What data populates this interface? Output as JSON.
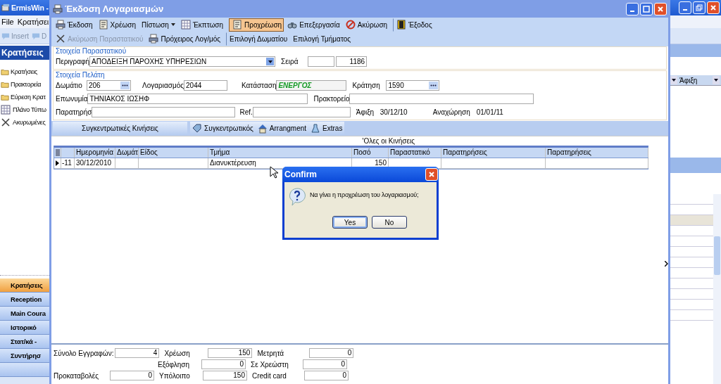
{
  "app": {
    "title": "ErmisWin -",
    "menu": [
      "File",
      "Κρατήσει"
    ],
    "toolbar": [
      "Insert",
      "D"
    ],
    "panel_title": "Κρατήσεις",
    "panel_items": [
      "Κρατήσεις",
      "Πρακτορεία",
      "Εύρεση Κρατ",
      "Πλάνο Τύπω",
      "Ακυρωμένες"
    ],
    "nav_buttons": [
      {
        "label": "Κρατήσεις",
        "selected": true
      },
      {
        "label": "Reception",
        "selected": false
      },
      {
        "label": "Main Coura",
        "selected": false
      },
      {
        "label": "Ιστορικό",
        "selected": false
      },
      {
        "label": "Στατ/κά -",
        "selected": false
      },
      {
        "label": "Συντήρησ",
        "selected": false
      }
    ],
    "right_column": "Άφιξη"
  },
  "window": {
    "title": "Έκδοση Λογαριασμών",
    "toolbar": [
      {
        "label": "Έκδοση",
        "selected": false,
        "has_menu": false,
        "separator_before": false
      },
      {
        "label": "Χρέωση",
        "selected": false,
        "has_menu": false,
        "separator_before": false
      },
      {
        "label": "Πίστωση",
        "selected": false,
        "has_menu": true,
        "separator_before": false
      },
      {
        "label": "Έκπτωση",
        "selected": false,
        "has_menu": false,
        "separator_before": false
      },
      {
        "label": "Προχρέωση",
        "selected": true,
        "has_menu": false,
        "separator_before": true
      },
      {
        "label": "Επεξεργασία",
        "selected": false,
        "has_menu": false,
        "separator_before": false
      },
      {
        "label": "Ακύρωση",
        "selected": false,
        "has_menu": false,
        "separator_before": false
      },
      {
        "label": "Έξοδος",
        "selected": false,
        "has_menu": false,
        "separator_before": true
      }
    ],
    "toolbar2": [
      {
        "label": "Ακύρωση Παραστατικού",
        "disabled": true,
        "separator_before": false
      },
      {
        "label": "Πρόχειρος Λογ/μός",
        "disabled": false,
        "separator_before": false
      },
      {
        "label": "Επιλογή Δωματίου",
        "disabled": false,
        "separator_before": true
      },
      {
        "label": "Επιλογή Τμήματος",
        "disabled": false,
        "separator_before": false
      }
    ],
    "document": {
      "heading": "Στοιχεία Παραστατικού",
      "description_label": "Περιγραφή",
      "description": "ΑΠΟΔΕΙΞΗ ΠΑΡΟΧΗΣ ΥΠΗΡΕΣΙΩΝ",
      "series_label": "Σειρά",
      "number": "1186"
    },
    "customer": {
      "heading": "Στοιχεία Πελάτη",
      "line_1": [
        {
          "kind": "field",
          "label": "Δωμάτιο",
          "value": "206",
          "lookup": true
        },
        {
          "kind": "field",
          "label": "Λογαριασμός",
          "value": "2044",
          "lookup": false
        },
        {
          "kind": "status",
          "label": "Κατάσταση",
          "value": "ΕΝΕΡΓΟΣ",
          "lookup": false
        },
        {
          "kind": "field",
          "label": "Κράτηση",
          "value": "1590",
          "lookup": true
        }
      ],
      "line_2": [
        {
          "kind": "field",
          "label": "Επωνυμία",
          "value": "ΤΗΝΙΑΚΟΣ ΙΩΣΗΦ",
          "lookup": false
        },
        {
          "kind": "field",
          "label": "Πρακτορείο",
          "lookup": false
        }
      ],
      "line_3": [
        {
          "kind": "field",
          "label": "Παρατηρήσ",
          "lookup": false
        },
        {
          "kind": "field",
          "label": "Ref.",
          "lookup": false
        },
        {
          "kind": "text",
          "label": "Άφιξη",
          "value": "30/12/10"
        },
        {
          "kind": "text",
          "label": "Αναχώρηση",
          "value": "01/01/11"
        }
      ]
    },
    "tabs": [
      "Συγκεντρωτικές Κινήσεις",
      "Συγκεντρωτικός",
      "Arrangment",
      "Extras"
    ],
    "grid": {
      "title": "'Ολες οι Κινήσεις",
      "columns": [
        "Ημερομηνία",
        "Δωμάτ",
        "Είδος",
        "Τμήμα",
        "Ποσό",
        "Παραστατικό",
        "Παρατηρήσεις",
        "Παρατηρήσεις"
      ],
      "rows": [
        {
          "current": true,
          "number": "-11",
          "cells": [
            "30/12/2010",
            null,
            null,
            "Διανυκτέρευση",
            "150",
            null,
            null,
            null
          ]
        }
      ]
    },
    "totals": [
      [
        {
          "label": "Σύνολο Εγγραφών:",
          "value": "4"
        },
        {
          "label": "Χρέωση",
          "value": "150"
        },
        {
          "label": "Μετρητά",
          "value": "0"
        }
      ],
      [
        {
          "label": "Εξόφληση",
          "value": "0"
        },
        {
          "label": "Σε Χρεώστη",
          "value": "0"
        }
      ],
      [
        {
          "label": "Προκαταβολές",
          "value": "0"
        },
        {
          "label": "Υπόλοιπο",
          "value": "150"
        },
        {
          "label": "Credit card",
          "value": "0"
        }
      ]
    ]
  },
  "dialog": {
    "title": "Confirm",
    "message": "Να γίνει η προχρέωση του λογαριασμού;",
    "buttons": [
      {
        "label": "Yes",
        "focused": true
      },
      {
        "label": "No",
        "focused": false
      }
    ]
  }
}
